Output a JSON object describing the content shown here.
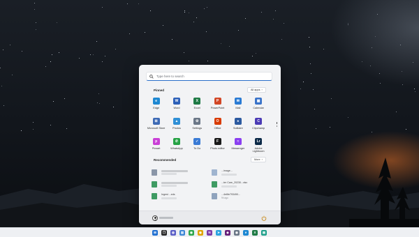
{
  "search": {
    "placeholder": "Type here to search"
  },
  "pinned": {
    "title": "Pinned",
    "all_apps_label": "All apps",
    "apps": [
      {
        "label": "Edge",
        "icon": "edge-icon",
        "color": "#1e88d2",
        "glyph": "e"
      },
      {
        "label": "Word",
        "icon": "word-icon",
        "color": "#2b5fb8",
        "glyph": "W"
      },
      {
        "label": "Excel",
        "icon": "excel-icon",
        "color": "#1e7a45",
        "glyph": "X"
      },
      {
        "label": "PowerPoint",
        "icon": "powerpoint-icon",
        "color": "#d24726",
        "glyph": "P"
      },
      {
        "label": "Mail",
        "icon": "mail-icon",
        "color": "#2a7bd4",
        "glyph": "✉"
      },
      {
        "label": "Calendar",
        "icon": "calendar-icon",
        "color": "#3a73c9",
        "glyph": "▦"
      },
      {
        "label": "Microsoft Store",
        "icon": "store-icon",
        "color": "#3d6ab5",
        "glyph": "⊞"
      },
      {
        "label": "Photos",
        "icon": "photos-icon",
        "color": "#2f8fd6",
        "glyph": "▲"
      },
      {
        "label": "Settings",
        "icon": "settings-icon",
        "color": "#6b7787",
        "glyph": "⚙"
      },
      {
        "label": "Office",
        "icon": "office-icon",
        "color": "#d83b01",
        "glyph": "O"
      },
      {
        "label": "Solitaire",
        "icon": "solitaire-icon",
        "color": "#2c5aa0",
        "glyph": "♠"
      },
      {
        "label": "Clipchamp",
        "icon": "clipchamp-icon",
        "color": "#4b3bb5",
        "glyph": "C"
      },
      {
        "label": "Picsart",
        "icon": "picsart-icon",
        "color": "#c93fd6",
        "glyph": "p"
      },
      {
        "label": "WhatsApp",
        "icon": "whatsapp-icon",
        "color": "#25a244",
        "glyph": "✆"
      },
      {
        "label": "To Do",
        "icon": "todo-icon",
        "color": "#3a7bd5",
        "glyph": "✓"
      },
      {
        "label": "Photo editor",
        "icon": "photo-editor-icon",
        "color": "#1a1a1a",
        "glyph": "F"
      },
      {
        "label": "Messenger",
        "icon": "messenger-icon",
        "color": "#8a3ff0",
        "glyph": "≈"
      },
      {
        "label": "Adobe Lightroom",
        "icon": "lightroom-icon",
        "color": "#0c2a48",
        "glyph": "Lr"
      }
    ]
  },
  "recommended": {
    "title": "Recommended",
    "more_label": "More",
    "items": [
      {
        "icon": "folder-icon",
        "color": "#8a96a8",
        "name": "",
        "sub": ""
      },
      {
        "icon": "image-file-icon",
        "color": "#9fb4cf",
        "name": "...image...",
        "sub": ""
      },
      {
        "icon": "excel-file-icon",
        "color": "#3f9b63",
        "name": "",
        "sub": ""
      },
      {
        "icon": "excel-file-icon",
        "color": "#3f9b63",
        "name": "...ter Care_20230...xlsx",
        "sub": ""
      },
      {
        "icon": "excel-file-icon",
        "color": "#3f9b63",
        "name": "Ingest ...eds",
        "sub": ""
      },
      {
        "icon": "image-file-icon",
        "color": "#8fa3bd",
        "name": "...4e6fe793490...",
        "sub": "9h ago"
      }
    ]
  },
  "taskbar": {
    "icons": [
      {
        "icon": "start-icon",
        "color": "#1f6fd1",
        "glyph": "⊞"
      },
      {
        "icon": "task-view-icon",
        "color": "#2b2b2b",
        "glyph": "❐"
      },
      {
        "icon": "chat-icon",
        "color": "#5b5fc7",
        "glyph": "◍"
      },
      {
        "icon": "widgets-icon",
        "color": "#3c86d6",
        "glyph": "▥"
      },
      {
        "icon": "chrome-icon",
        "color": "#2fa84f",
        "glyph": "◉"
      },
      {
        "icon": "chrome-canary-icon",
        "color": "#e0a400",
        "glyph": "◉"
      },
      {
        "icon": "onenote-icon",
        "color": "#7b3aa8",
        "glyph": "N"
      },
      {
        "icon": "telegram-icon",
        "color": "#2aa3e0",
        "glyph": "➤"
      },
      {
        "icon": "visual-studio-icon",
        "color": "#68217a",
        "glyph": "◆"
      },
      {
        "icon": "chrome-dev-icon",
        "color": "#6b7787",
        "glyph": "◉"
      },
      {
        "icon": "edge-taskbar-icon",
        "color": "#1e88d2",
        "glyph": "e"
      },
      {
        "icon": "excel-taskbar-icon",
        "color": "#1e7a45",
        "glyph": "X"
      },
      {
        "icon": "word-taskbar-icon",
        "color": "#1e9f8a",
        "glyph": "▤"
      }
    ]
  }
}
